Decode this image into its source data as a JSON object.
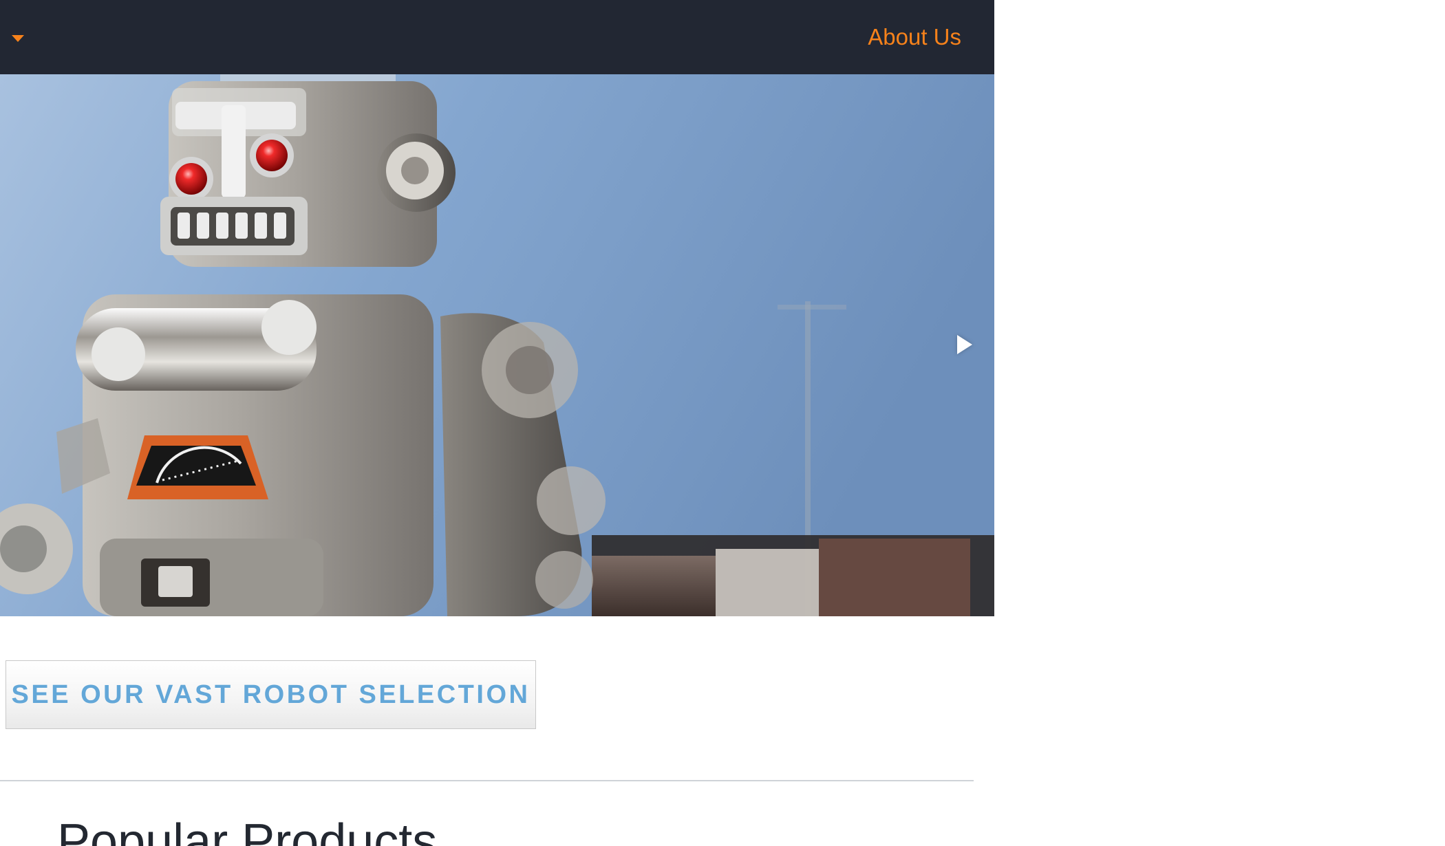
{
  "nav": {
    "about_label": "About Us",
    "accent": "#f7821b",
    "background": "#222733"
  },
  "hero": {
    "image_subject": "robot",
    "next_control_icon": "play-right-icon"
  },
  "cta": {
    "label": "SEE OUR VAST ROBOT SELECTION",
    "text_color": "#63a7d8"
  },
  "section": {
    "title": "Popular Products"
  },
  "icons": {
    "menu": "chevron-down-icon",
    "slider_next": "play-right-icon"
  }
}
